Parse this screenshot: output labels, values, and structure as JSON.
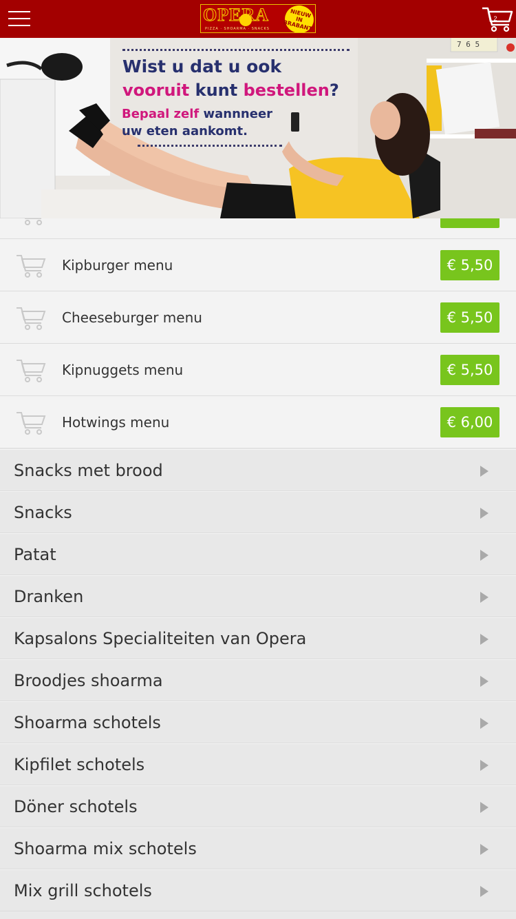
{
  "header": {
    "logo": {
      "word": "OPERA",
      "coin_letter": "0",
      "tagline": "PIZZA · SHOARMA · SNACKS",
      "badge": "NIEUW IN BRABANT"
    },
    "cart_count": "2"
  },
  "banner": {
    "line1": "Wist u dat u ook",
    "line2_a": "vooruit",
    "line2_b": "kunt",
    "line2_c": "bestellen",
    "line2_d": "?",
    "line3_a": "Bepaal zelf",
    "line3_b": "wannneer",
    "line4": "uw eten aankomt.",
    "clock_digits": "7 6 5"
  },
  "products": [
    {
      "name": "Kipburger menu",
      "price": "€ 5,50"
    },
    {
      "name": "Cheeseburger menu",
      "price": "€ 5,50"
    },
    {
      "name": "Kipnuggets menu",
      "price": "€ 5,50"
    },
    {
      "name": "Hotwings menu",
      "price": "€ 6,00"
    }
  ],
  "categories": [
    "Snacks met brood",
    "Snacks",
    "Patat",
    "Dranken",
    "Kapsalons Specialiteiten van Opera",
    "Broodjes shoarma",
    "Shoarma schotels",
    "Kipfilet schotels",
    "Döner schotels",
    "Shoarma mix schotels",
    "Mix grill schotels"
  ],
  "colors": {
    "header_bg": "#a30000",
    "price_bg": "#78c51d",
    "banner_navy": "#27306e",
    "banner_pink": "#d0177c"
  },
  "icons": {
    "menu": "hamburger-icon",
    "cart": "shopping-cart-icon",
    "row_cart": "add-to-cart-icon",
    "expand": "chevron-right-icon"
  }
}
